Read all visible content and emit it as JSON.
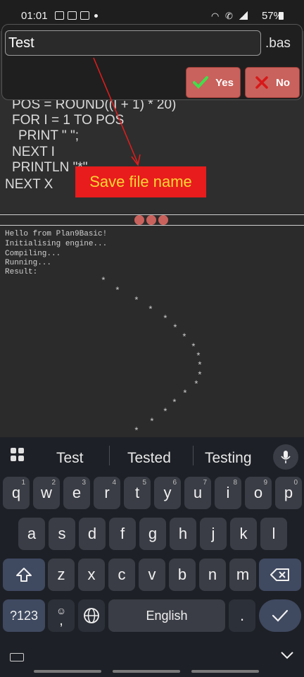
{
  "status_bar": {
    "time": "01:01",
    "battery": "57%"
  },
  "code_lines": [
    "POS = ROUND((I + 1) * 20)",
    "FOR I = 1 TO POS",
    "PRINT \" \";",
    "NEXT I",
    "PRINTLN \"*\"",
    "NEXT X"
  ],
  "dialog": {
    "filename_value": "Test",
    "extension": ".bas",
    "yes_label": "Yes",
    "no_label": "No"
  },
  "annotation": {
    "label": "Save file name"
  },
  "console": {
    "lines": [
      "Hello from Plan9Basic!",
      "Initialising engine...",
      "Compiling...",
      "Running...",
      "Result:"
    ],
    "star": "*"
  },
  "keyboard": {
    "suggestions": [
      "Test",
      "Tested",
      "Testing"
    ],
    "row1": [
      {
        "k": "q",
        "h": "1"
      },
      {
        "k": "w",
        "h": "2"
      },
      {
        "k": "e",
        "h": "3"
      },
      {
        "k": "r",
        "h": "4"
      },
      {
        "k": "t",
        "h": "5"
      },
      {
        "k": "y",
        "h": "6"
      },
      {
        "k": "u",
        "h": "7"
      },
      {
        "k": "i",
        "h": "8"
      },
      {
        "k": "o",
        "h": "9"
      },
      {
        "k": "p",
        "h": "0"
      }
    ],
    "row2": [
      "a",
      "s",
      "d",
      "f",
      "g",
      "h",
      "j",
      "k",
      "l"
    ],
    "row3": [
      "z",
      "x",
      "c",
      "v",
      "b",
      "n",
      "m"
    ],
    "symbols_label": "?123",
    "emoji_comma": ",",
    "space_label": "English",
    "period": "."
  },
  "colors": {
    "accent": "#c9625c",
    "annotation_bg": "#e81c1c",
    "annotation_text": "#ffd633"
  }
}
